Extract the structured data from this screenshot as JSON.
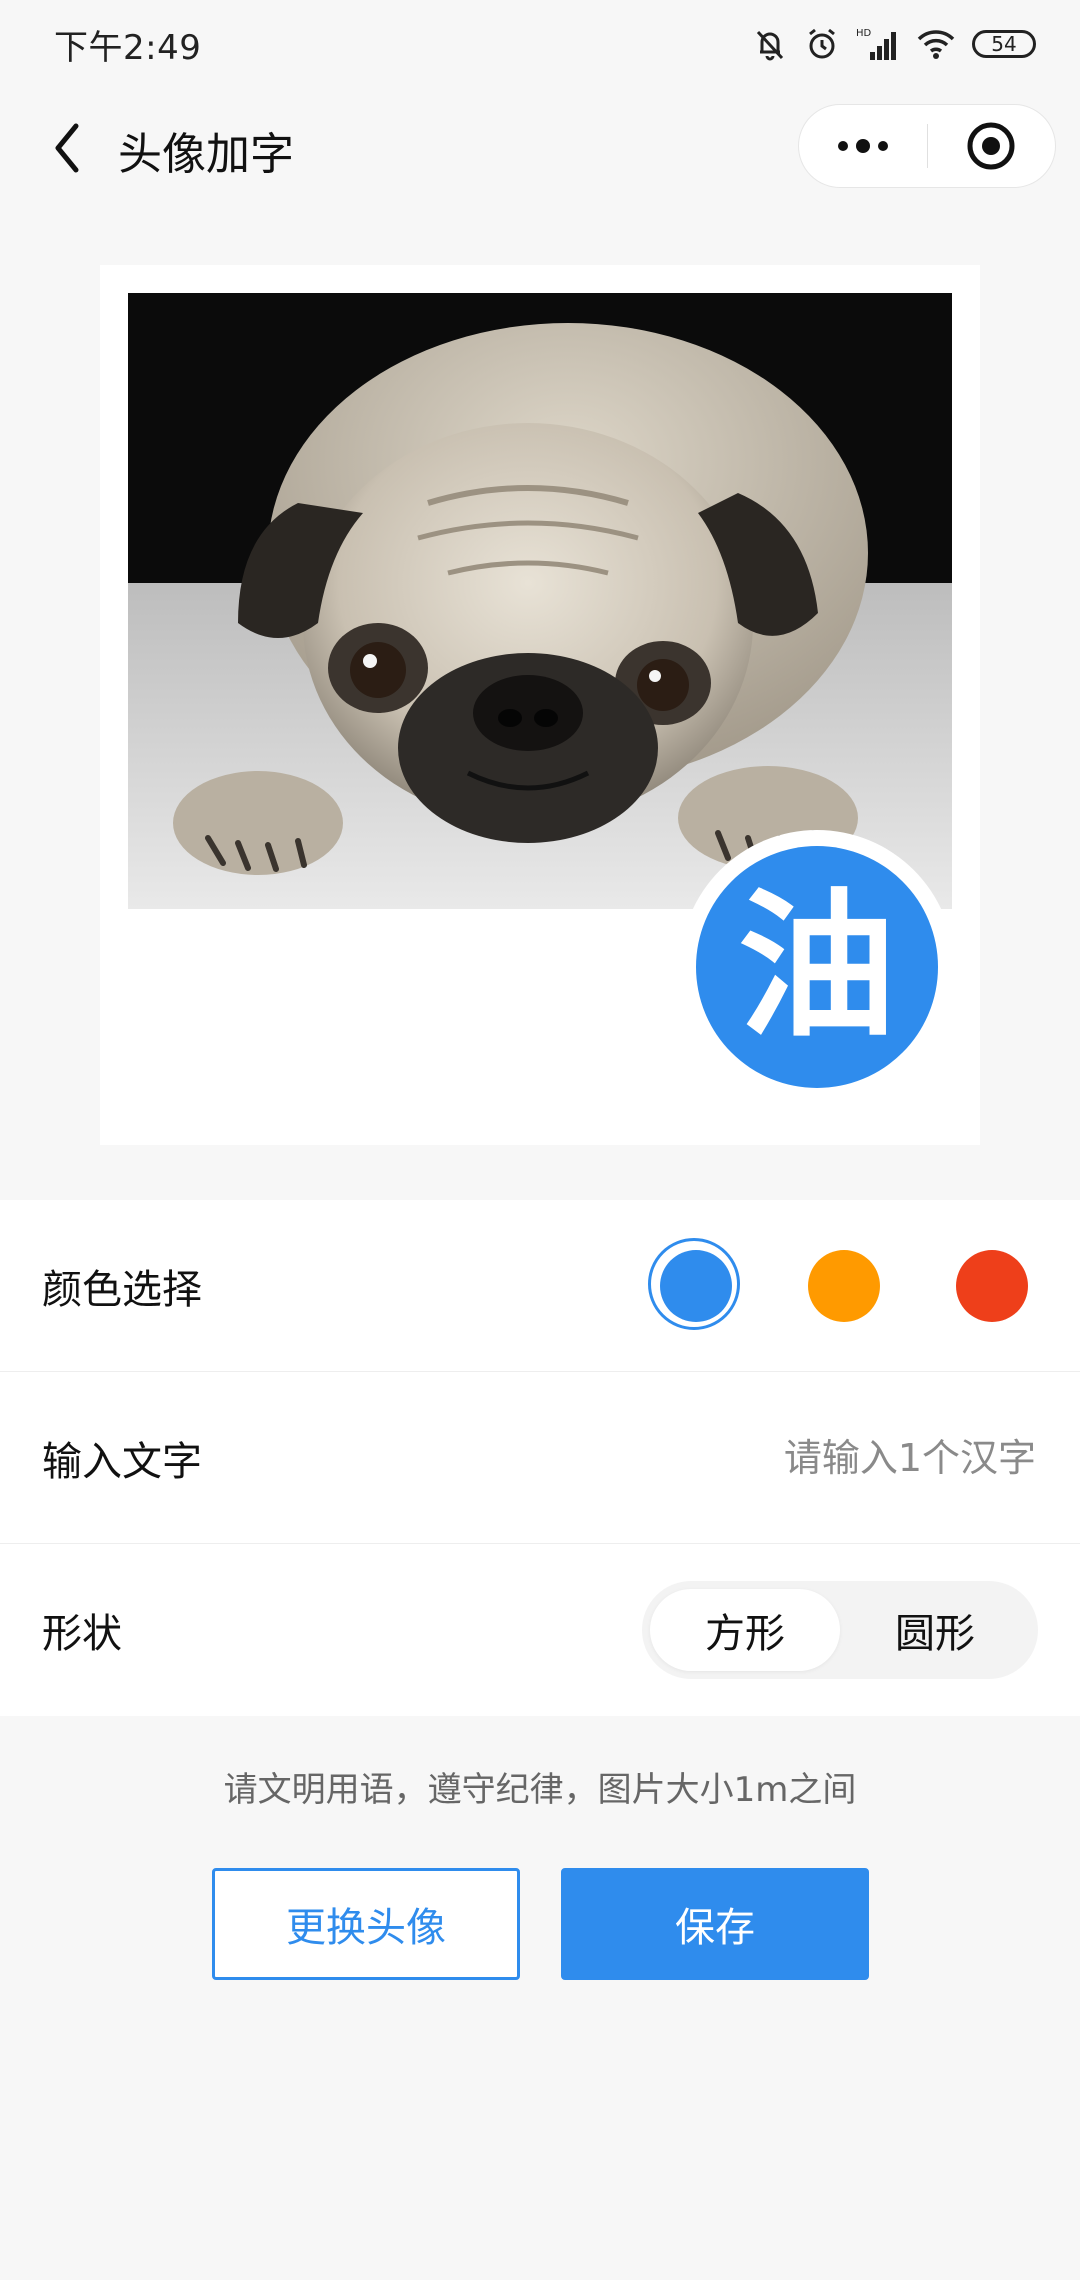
{
  "status_bar": {
    "time": "下午2:49",
    "battery": "54",
    "network_label": "HD"
  },
  "nav": {
    "title": "头像加字",
    "icons": {
      "back": "chevron-left-icon",
      "more": "more-dots-icon",
      "close": "target-circle-icon"
    }
  },
  "preview": {
    "badge_char": "油",
    "badge_color": "#2f8ced",
    "photo_subject": "pug"
  },
  "settings": {
    "color_label": "颜色选择",
    "colors": [
      {
        "name": "blue",
        "hex": "#2f8ced",
        "selected": true
      },
      {
        "name": "orange",
        "hex": "#ff9a00",
        "selected": false
      },
      {
        "name": "red",
        "hex": "#ee3f1a",
        "selected": false
      }
    ],
    "text_label": "输入文字",
    "text_value": "",
    "text_placeholder": "请输入1个汉字",
    "shape_label": "形状",
    "shape_options": [
      "方形",
      "圆形"
    ],
    "shape_selected": "方形"
  },
  "notice": "请文明用语，遵守纪律，图片大小1m之间",
  "buttons": {
    "change_avatar": "更换头像",
    "save": "保存"
  }
}
